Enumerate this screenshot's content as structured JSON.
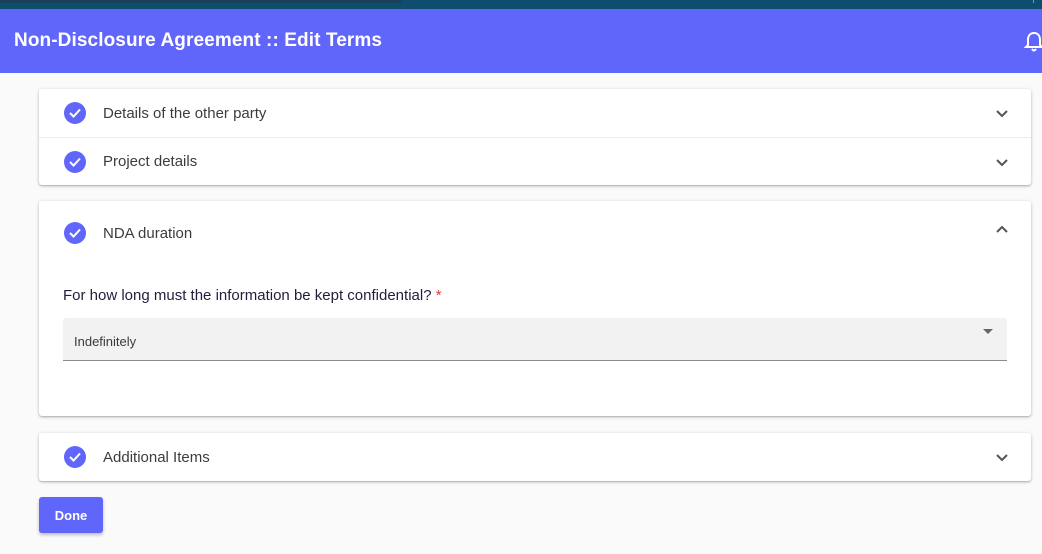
{
  "app": {
    "title": "Non-Disclosure Agreement  ::  Edit Terms"
  },
  "icons": {
    "notifications": "bell-icon",
    "step_status": "check-circle-icon",
    "expand": "chevron-down-icon",
    "collapse": "chevron-up-icon",
    "dropdown": "caret-down-icon"
  },
  "colors": {
    "accent": "#6166fb",
    "required": "#e53935",
    "top_strip": "#0f4d6e"
  },
  "sections": [
    {
      "label": "Details of the other party",
      "expanded": false,
      "complete": true
    },
    {
      "label": "Project details",
      "expanded": false,
      "complete": true
    },
    {
      "label": "NDA duration",
      "expanded": true,
      "complete": true
    },
    {
      "label": "Additional Items",
      "expanded": false,
      "complete": true
    }
  ],
  "nda_duration": {
    "question": "For how long must the information be kept confidential?",
    "required_marker": "*",
    "selected_value": "Indefinitely"
  },
  "actions": {
    "done_label": "Done"
  }
}
